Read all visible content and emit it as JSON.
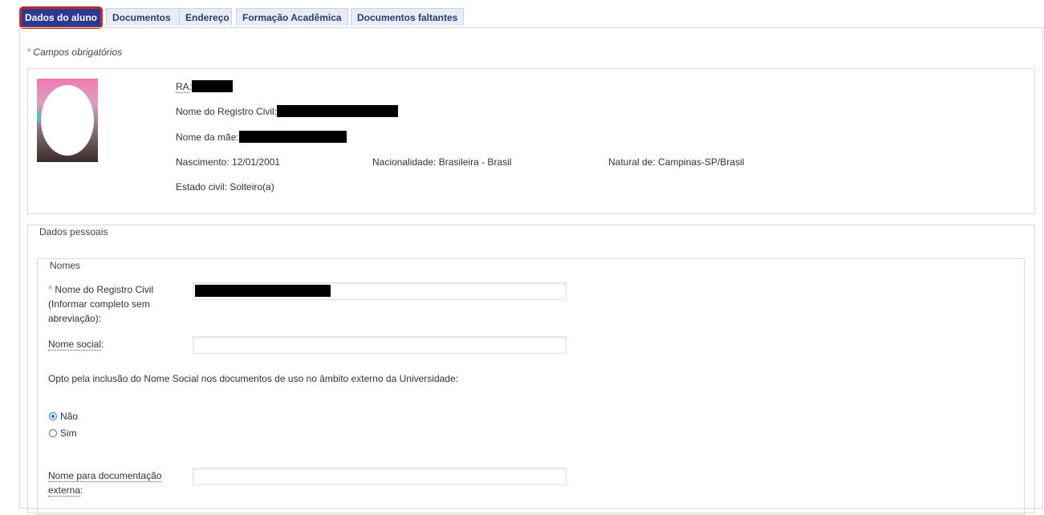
{
  "tabs": [
    {
      "label": "Dados do aluno",
      "active": true
    },
    {
      "label": "Documentos"
    },
    {
      "label": "Endereço"
    },
    {
      "label": "Formação Acadêmica"
    },
    {
      "label": "Documentos faltantes"
    }
  ],
  "required_note": "Campos obrigatórios",
  "student_info": {
    "ra_label": "RA",
    "ra_separator": ":",
    "civil_name_label": "Nome do Registro Civil:",
    "mother_name_label": "Nome da mãe:",
    "birth": "Nascimento: 12/01/2001",
    "nationality": "Nacionalidade: Brasileira - Brasil",
    "natural": "Natural de: Campinas-SP/Brasil",
    "marital_status": "Estado civil: Solteiro(a)"
  },
  "personal_section": {
    "legend": "Dados pessoais",
    "names_legend": "Nomes",
    "civil_name_field_label_line1": "Nome do Registro Civil",
    "civil_name_field_label_line2": "(Informar completo sem",
    "civil_name_field_label_line3": "abreviação):",
    "social_name_label": "Nome social",
    "social_name_suffix": ":",
    "opt_text": "Opto pela inclusão do Nome Social nos documentos de uso no âmbito externo da Universidade:",
    "radio_options": [
      {
        "label": "Não",
        "checked": true
      },
      {
        "label": "Sim",
        "checked": false
      }
    ],
    "external_name_label_line1": "Nome para documentação",
    "external_name_label_line2": "externa",
    "external_name_suffix": ":"
  },
  "colors": {
    "active_tab_bg": "#2b3990",
    "active_tab_border": "#c02a2a",
    "tab_bg": "#e8ecf6",
    "required_star": "#e58b2e",
    "radio_selected": "#1a73e8"
  }
}
